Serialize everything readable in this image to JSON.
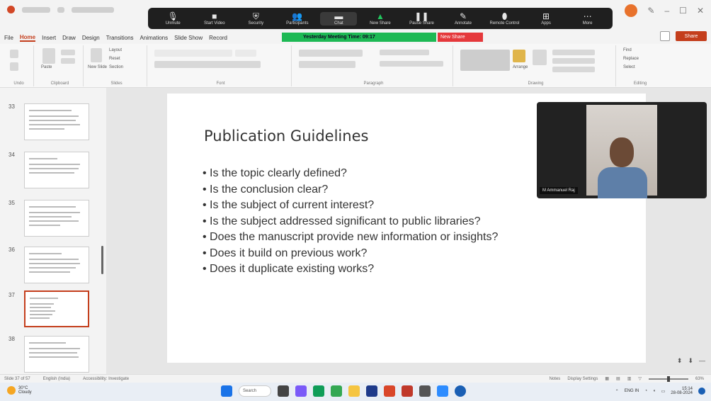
{
  "zoom_toolbar": {
    "items": [
      {
        "label": "Unmute",
        "icon": "microphone-icon"
      },
      {
        "label": "Start Video",
        "icon": "video-camera-icon"
      },
      {
        "label": "Security",
        "icon": "shield-icon"
      },
      {
        "label": "Participants",
        "icon": "participants-icon"
      },
      {
        "label": "Chat",
        "icon": "chat-icon"
      },
      {
        "label": "New Share",
        "icon": "share-screen-icon"
      },
      {
        "label": "Pause Share",
        "icon": "pause-icon"
      },
      {
        "label": "Annotate",
        "icon": "pen-icon"
      },
      {
        "label": "Remote Control",
        "icon": "mouse-icon"
      },
      {
        "label": "Apps",
        "icon": "apps-icon"
      },
      {
        "label": "More",
        "icon": "more-icon"
      }
    ]
  },
  "menu": {
    "tabs": [
      "File",
      "Home",
      "Insert",
      "Draw",
      "Design",
      "Transitions",
      "Animations",
      "Slide Show",
      "Record"
    ],
    "active_tab": "Home",
    "meeting_banner": "Yesterday Meeting Time: 09:17",
    "stop_share": "New Share",
    "share_label": "Share"
  },
  "ribbon": {
    "groups": [
      "Undo",
      "Clipboard",
      "Slides",
      "Font",
      "Paragraph",
      "Drawing",
      "Editing"
    ],
    "paste_label": "Paste",
    "new_slide_label": "New Slide",
    "layout_label": "Layout",
    "reset_label": "Reset",
    "section_label": "Section",
    "arrange_label": "Arrange",
    "find_label": "Find",
    "replace_label": "Replace",
    "select_label": "Select"
  },
  "thumbnails": [
    {
      "num": "33",
      "selected": false
    },
    {
      "num": "34",
      "selected": false
    },
    {
      "num": "35",
      "selected": false
    },
    {
      "num": "36",
      "selected": false
    },
    {
      "num": "37",
      "selected": true
    },
    {
      "num": "38",
      "selected": false
    }
  ],
  "slide": {
    "title": "Publication Guidelines",
    "bullets": [
      "Is the topic clearly defined?",
      "Is the conclusion clear?",
      "Is the subject of current interest?",
      "Is the subject addressed significant to public libraries?",
      "Does the manuscript provide new information or insights?",
      "Does it build on previous work?",
      "Does it duplicate existing works?"
    ]
  },
  "video": {
    "participant_name": "M Ammanuel Raj"
  },
  "statusbar": {
    "slide_counter": "Slide 37 of 57",
    "language": "English (India)",
    "accessibility": "Accessibility: Investigate",
    "notes": "Notes",
    "display_settings": "Display Settings",
    "zoom": "63%"
  },
  "taskbar": {
    "weather_temp": "30°C",
    "weather_desc": "Cloudy",
    "search_label": "Search",
    "lang": "ENG IN",
    "time": "15:14",
    "date": "28-08-2024"
  }
}
